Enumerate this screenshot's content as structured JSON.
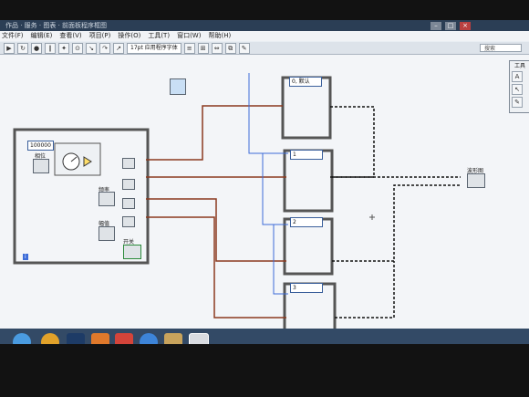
{
  "window": {
    "title": "作品 · 服务 · 图表 · 前面板程序框图"
  },
  "menu": [
    "文件(F)",
    "编辑(E)",
    "查看(V)",
    "项目(P)",
    "操作(O)",
    "工具(T)",
    "窗口(W)",
    "帮助(H)"
  ],
  "toolbar": {
    "font": "17pt 应用程序字体",
    "search_placeholder": "搜索"
  },
  "diagram": {
    "constant_100000": "100000",
    "label_phase": "相位",
    "label_freq": "频率",
    "label_amp": "幅值",
    "label_switch": "开关",
    "label_waveform": "波形图",
    "case1": "1",
    "case2": "2",
    "case3": "3",
    "case0": "0, 默认",
    "loop_index": "i"
  },
  "tools_panel": {
    "title": "工具"
  },
  "colors": {
    "wire_orange": "#8b3a1f",
    "wire_blue": "#3c6cd8",
    "wire_black": "#111111"
  }
}
